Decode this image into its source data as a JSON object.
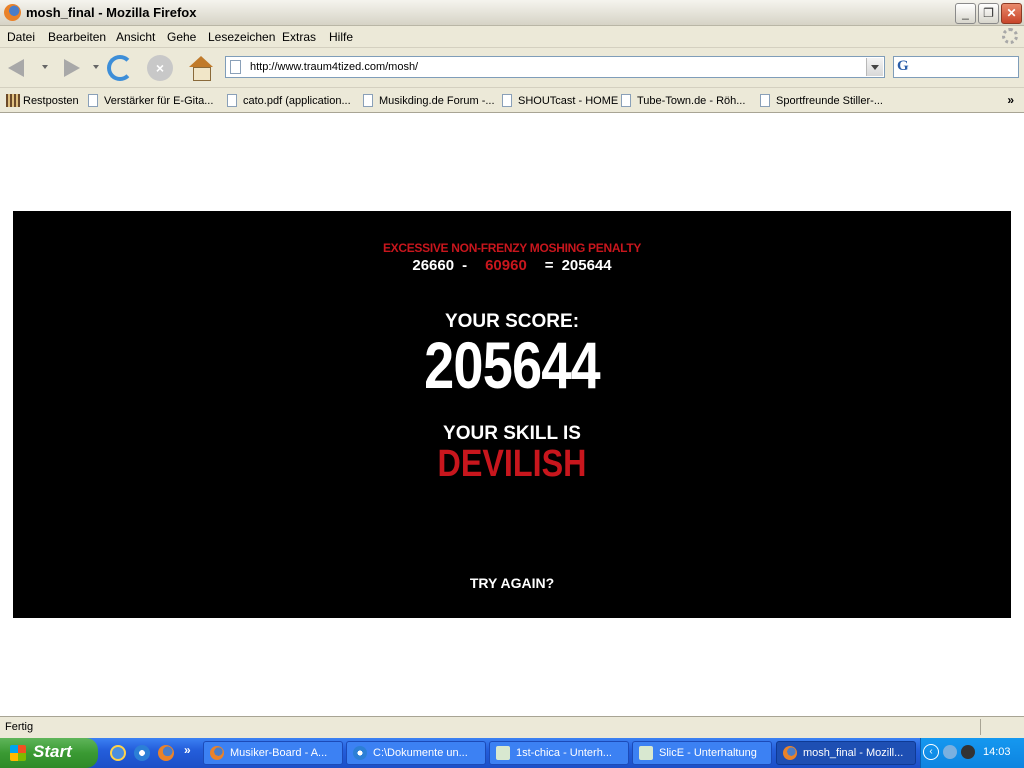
{
  "window": {
    "title": "mosh_final - Mozilla Firefox",
    "buttons": {
      "minimize": "_",
      "maximize": "❐",
      "close": "✕"
    }
  },
  "menu": [
    "Datei",
    "Bearbeiten",
    "Ansicht",
    "Gehe",
    "Lesezeichen",
    "Extras",
    "Hilfe"
  ],
  "navigation": {
    "url": "http://www.traum4tized.com/mosh/",
    "search_engine_glyph": "G"
  },
  "bookmarks": {
    "items": [
      "Restposten",
      "Verstärker für E-Gita...",
      "cato.pdf (application...",
      "Musikding.de Forum -...",
      "SHOUTcast - HOME",
      "Tube-Town.de - Röh...",
      "Sportfreunde Stiller-..."
    ],
    "overflow": "»"
  },
  "game": {
    "penalty_label": "EXCESSIVE NON-FRENZY MOSHING PENALTY",
    "calc_base": "26660",
    "calc_minus": "-",
    "calc_penalty": "60960",
    "calc_equals": "=",
    "calc_result": "205644",
    "score_label": "YOUR SCORE:",
    "score": "205644",
    "skill_label": "YOUR SKILL IS",
    "skill": "DEVILISH",
    "try_again": "TRY AGAIN?",
    "colors": {
      "accent_red": "#c8161d",
      "background": "#000000",
      "text": "#ffffff"
    }
  },
  "status": {
    "text": "Fertig"
  },
  "taskbar": {
    "start_label": "Start",
    "quick_launch_more": "»",
    "tasks": [
      {
        "label": "Musiker-Board - A...",
        "icon": "firefox-icon"
      },
      {
        "label": "C:\\Dokumente un...",
        "icon": "explorer-icon"
      },
      {
        "label": "1st-chica - Unterh...",
        "icon": "slice-icon"
      },
      {
        "label": "SlicE - Unterhaltung",
        "icon": "slice-icon"
      },
      {
        "label": "mosh_final - Mozill...",
        "icon": "firefox-icon",
        "active": true
      }
    ],
    "tray_arrow": "‹",
    "clock": "14:03"
  }
}
